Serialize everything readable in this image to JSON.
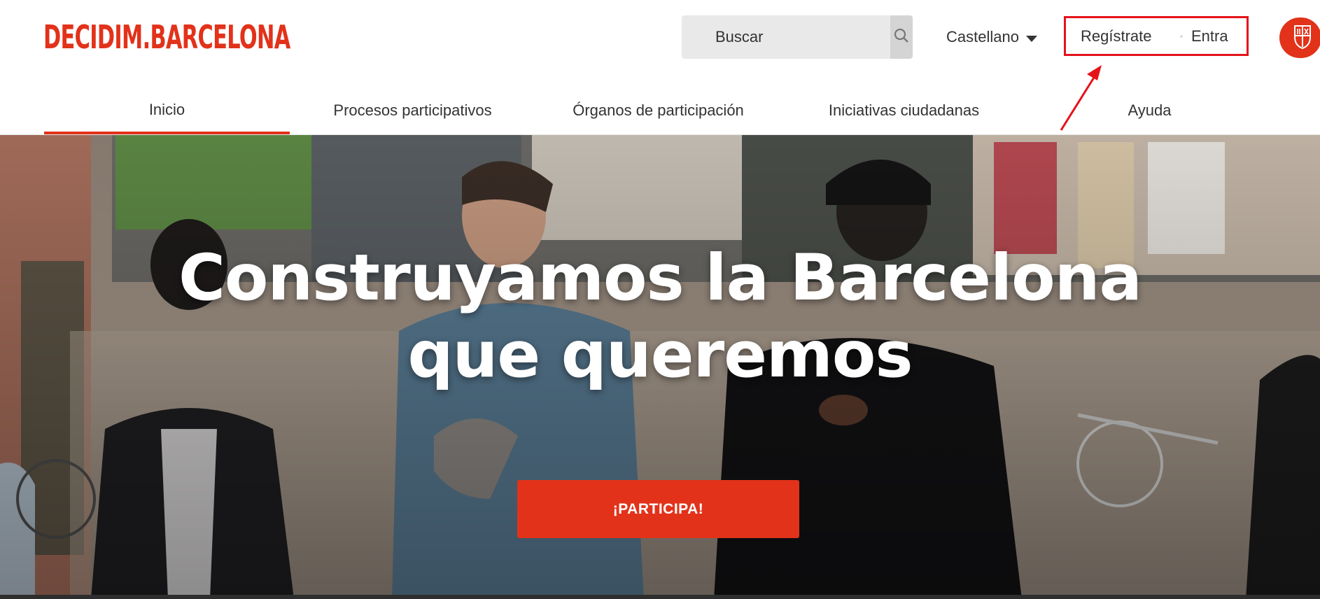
{
  "header": {
    "logo_text": "DECIDIM.BARCELONA",
    "search": {
      "placeholder": "Buscar",
      "icon": "search-icon"
    },
    "language": {
      "selected": "Castellano",
      "icon": "caret-down-icon"
    },
    "auth": {
      "register_label": "Regístrate",
      "login_label": "Entra"
    },
    "city_badge_icon": "barcelona-seal-icon"
  },
  "nav": {
    "items": [
      {
        "label": "Inicio",
        "active": true
      },
      {
        "label": "Procesos participativos",
        "active": false
      },
      {
        "label": "Órganos de participación",
        "active": false
      },
      {
        "label": "Iniciativas ciudadanas",
        "active": false
      },
      {
        "label": "Ayuda",
        "active": false
      }
    ]
  },
  "hero": {
    "title_line1": "Construyamos la Barcelona",
    "title_line2": "que queremos",
    "cta_label": "¡PARTICIPA!"
  },
  "colors": {
    "brand_red": "#e2321a",
    "annotation_red": "#e4141b",
    "text": "#333333",
    "search_bg": "#e9e9e9"
  }
}
